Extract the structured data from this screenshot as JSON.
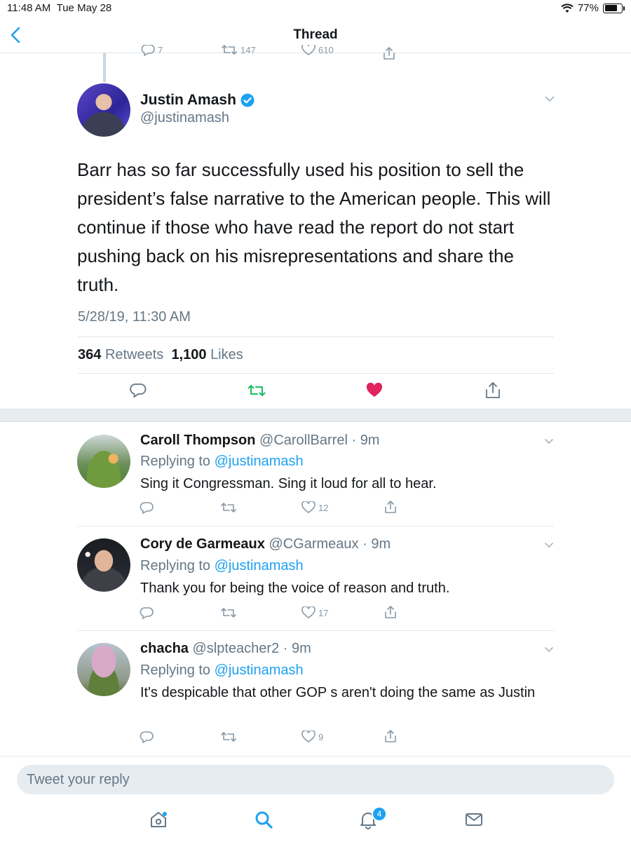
{
  "status_bar": {
    "time": "11:48 AM",
    "date": "Tue May 28",
    "battery": "77%"
  },
  "nav": {
    "title": "Thread"
  },
  "prev_tweet_counts": {
    "replies": "7",
    "retweets": "147",
    "likes": "610"
  },
  "main_tweet": {
    "name": "Justin Amash",
    "handle": "@justinamash",
    "text": "Barr has so far successfully used his position to sell the president’s false narrative to the American people. This will continue if those who have read the report do not start pushing back on his misrepresentations and share the truth.",
    "timestamp": "5/28/19, 11:30 AM",
    "retweets_count": "364",
    "retweets_label": "Retweets",
    "likes_count": "1,100",
    "likes_label": "Likes"
  },
  "replies": [
    {
      "name": "Caroll Thompson",
      "handle": "@CarollBarrel",
      "time": "9m",
      "replying_prefix": "Replying to",
      "replying_to": "@justinamash",
      "text": "Sing it Congressman.  Sing it loud for all to hear.",
      "likes": "12"
    },
    {
      "name": "Cory de Garmeaux",
      "handle": "@CGarmeaux",
      "time": "9m",
      "replying_prefix": "Replying to",
      "replying_to": "@justinamash",
      "text": "Thank you for being the voice of reason and truth.",
      "likes": "17"
    },
    {
      "name": "chacha",
      "handle": "@slpteacher2",
      "time": "9m",
      "replying_prefix": "Replying to",
      "replying_to": "@justinamash",
      "text": "It's despicable that other GOP s aren't doing the same as Justin",
      "likes": "9"
    }
  ],
  "reply_bar": {
    "placeholder": "Tweet your reply"
  },
  "tab_bar": {
    "notifications_badge": "4"
  },
  "icons": [
    "wifi-icon",
    "battery-icon",
    "back-chevron-icon",
    "verified-badge-icon",
    "chevron-down-icon",
    "reply-icon",
    "retweet-icon",
    "like-icon",
    "share-icon",
    "home-icon",
    "search-icon",
    "notifications-icon",
    "messages-icon"
  ],
  "colors": {
    "accent": "#1da1f2",
    "retweet_green": "#17bf63",
    "like_red": "#e0245e",
    "muted": "#657786"
  }
}
